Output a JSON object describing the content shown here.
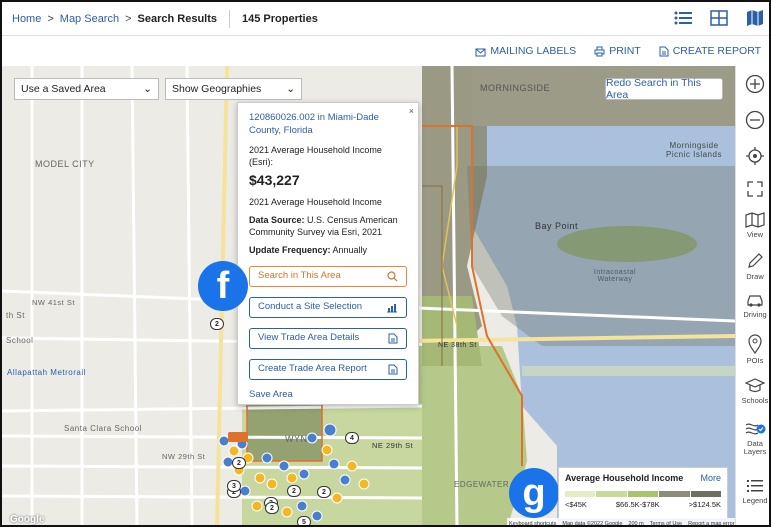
{
  "breadcrumb": {
    "home": "Home",
    "search": "Map Search",
    "current": "Search Results",
    "sep": ">"
  },
  "count": "145 Properties",
  "actions": {
    "mailing": "MAILING LABELS",
    "print": "PRINT",
    "report": "CREATE REPORT"
  },
  "map": {
    "saved_area": "Use a Saved Area",
    "geographies": "Show Geographies",
    "redo": "Redo Search in This Area",
    "labels": {
      "model_city": "MODEL CITY",
      "morningside": "MORNINGSIDE",
      "morningside_park": "Morningside Picnic Islands",
      "bay_point": "Bay Point",
      "intracoastal": "Intracoastal Waterway",
      "edgewater": "EDGEWATER",
      "wynwood": "WYN",
      "allapattah": "Allapattah Metrorail",
      "santa_clara": "Santa Clara School",
      "nw41": "NW 41st St",
      "th_st": "th St",
      "school": "School",
      "nw29": "NW 29th St",
      "ne29": "NE 29th St",
      "ne38": "NE 38th St",
      "google": "Google"
    }
  },
  "popup": {
    "close": "×",
    "title": "120860026.002 in Miami-Dade County, Florida",
    "metric": "2021 Average Household Income (Esri):",
    "value": "$43,227",
    "metric2": "2021 Average Household Income",
    "source_label": "Data Source:",
    "source": "U.S. Census American Community Survey via Esri, 2021",
    "freq_label": "Update Frequency:",
    "freq": "Annually",
    "btn_search": "Search in This Area",
    "btn_site": "Conduct a Site Selection",
    "btn_trade": "View Trade Area Details",
    "btn_report": "Create Trade Area Report",
    "save": "Save Area"
  },
  "badges": {
    "f": "f",
    "g": "g"
  },
  "legend": {
    "title": "Average Household Income",
    "more": "More",
    "low": "<$45K",
    "mid": "$66.5K-$78K",
    "high": ">$124.5K",
    "colors": [
      "#e4ebc6",
      "#c9d99a",
      "#a9c46d",
      "#8c8c78",
      "#6e6e62"
    ]
  },
  "attribution": {
    "keys": "Keyboard shortcuts",
    "data": "Map data ©2022 Google",
    "scale": "200 m",
    "terms": "Terms of Use",
    "report": "Report a map error"
  },
  "sidebar": {
    "view": "View",
    "draw": "Draw",
    "driving": "Driving",
    "pois": "POIs",
    "schools": "Schools",
    "data_layers": "Data Layers",
    "legend": "Legend"
  },
  "cluster_counts": [
    "2",
    "2",
    "4",
    "2",
    "2",
    "3",
    "2",
    "5",
    "2",
    "2"
  ]
}
